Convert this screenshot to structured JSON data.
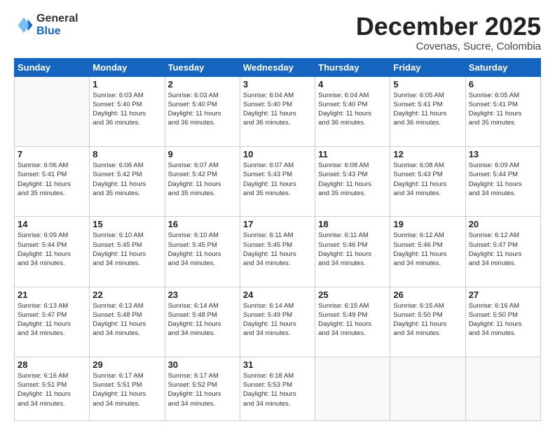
{
  "header": {
    "logo_general": "General",
    "logo_blue": "Blue",
    "month": "December 2025",
    "location": "Covenas, Sucre, Colombia"
  },
  "weekdays": [
    "Sunday",
    "Monday",
    "Tuesday",
    "Wednesday",
    "Thursday",
    "Friday",
    "Saturday"
  ],
  "weeks": [
    [
      {
        "day": "",
        "info": ""
      },
      {
        "day": "1",
        "info": "Sunrise: 6:03 AM\nSunset: 5:40 PM\nDaylight: 11 hours\nand 36 minutes."
      },
      {
        "day": "2",
        "info": "Sunrise: 6:03 AM\nSunset: 5:40 PM\nDaylight: 11 hours\nand 36 minutes."
      },
      {
        "day": "3",
        "info": "Sunrise: 6:04 AM\nSunset: 5:40 PM\nDaylight: 11 hours\nand 36 minutes."
      },
      {
        "day": "4",
        "info": "Sunrise: 6:04 AM\nSunset: 5:40 PM\nDaylight: 11 hours\nand 36 minutes."
      },
      {
        "day": "5",
        "info": "Sunrise: 6:05 AM\nSunset: 5:41 PM\nDaylight: 11 hours\nand 36 minutes."
      },
      {
        "day": "6",
        "info": "Sunrise: 6:05 AM\nSunset: 5:41 PM\nDaylight: 11 hours\nand 35 minutes."
      }
    ],
    [
      {
        "day": "7",
        "info": "Sunrise: 6:06 AM\nSunset: 5:41 PM\nDaylight: 11 hours\nand 35 minutes."
      },
      {
        "day": "8",
        "info": "Sunrise: 6:06 AM\nSunset: 5:42 PM\nDaylight: 11 hours\nand 35 minutes."
      },
      {
        "day": "9",
        "info": "Sunrise: 6:07 AM\nSunset: 5:42 PM\nDaylight: 11 hours\nand 35 minutes."
      },
      {
        "day": "10",
        "info": "Sunrise: 6:07 AM\nSunset: 5:43 PM\nDaylight: 11 hours\nand 35 minutes."
      },
      {
        "day": "11",
        "info": "Sunrise: 6:08 AM\nSunset: 5:43 PM\nDaylight: 11 hours\nand 35 minutes."
      },
      {
        "day": "12",
        "info": "Sunrise: 6:08 AM\nSunset: 5:43 PM\nDaylight: 11 hours\nand 34 minutes."
      },
      {
        "day": "13",
        "info": "Sunrise: 6:09 AM\nSunset: 5:44 PM\nDaylight: 11 hours\nand 34 minutes."
      }
    ],
    [
      {
        "day": "14",
        "info": "Sunrise: 6:09 AM\nSunset: 5:44 PM\nDaylight: 11 hours\nand 34 minutes."
      },
      {
        "day": "15",
        "info": "Sunrise: 6:10 AM\nSunset: 5:45 PM\nDaylight: 11 hours\nand 34 minutes."
      },
      {
        "day": "16",
        "info": "Sunrise: 6:10 AM\nSunset: 5:45 PM\nDaylight: 11 hours\nand 34 minutes."
      },
      {
        "day": "17",
        "info": "Sunrise: 6:11 AM\nSunset: 5:45 PM\nDaylight: 11 hours\nand 34 minutes."
      },
      {
        "day": "18",
        "info": "Sunrise: 6:11 AM\nSunset: 5:46 PM\nDaylight: 11 hours\nand 34 minutes."
      },
      {
        "day": "19",
        "info": "Sunrise: 6:12 AM\nSunset: 5:46 PM\nDaylight: 11 hours\nand 34 minutes."
      },
      {
        "day": "20",
        "info": "Sunrise: 6:12 AM\nSunset: 5:47 PM\nDaylight: 11 hours\nand 34 minutes."
      }
    ],
    [
      {
        "day": "21",
        "info": "Sunrise: 6:13 AM\nSunset: 5:47 PM\nDaylight: 11 hours\nand 34 minutes."
      },
      {
        "day": "22",
        "info": "Sunrise: 6:13 AM\nSunset: 5:48 PM\nDaylight: 11 hours\nand 34 minutes."
      },
      {
        "day": "23",
        "info": "Sunrise: 6:14 AM\nSunset: 5:48 PM\nDaylight: 11 hours\nand 34 minutes."
      },
      {
        "day": "24",
        "info": "Sunrise: 6:14 AM\nSunset: 5:49 PM\nDaylight: 11 hours\nand 34 minutes."
      },
      {
        "day": "25",
        "info": "Sunrise: 6:15 AM\nSunset: 5:49 PM\nDaylight: 11 hours\nand 34 minutes."
      },
      {
        "day": "26",
        "info": "Sunrise: 6:15 AM\nSunset: 5:50 PM\nDaylight: 11 hours\nand 34 minutes."
      },
      {
        "day": "27",
        "info": "Sunrise: 6:16 AM\nSunset: 5:50 PM\nDaylight: 11 hours\nand 34 minutes."
      }
    ],
    [
      {
        "day": "28",
        "info": "Sunrise: 6:16 AM\nSunset: 5:51 PM\nDaylight: 11 hours\nand 34 minutes."
      },
      {
        "day": "29",
        "info": "Sunrise: 6:17 AM\nSunset: 5:51 PM\nDaylight: 11 hours\nand 34 minutes."
      },
      {
        "day": "30",
        "info": "Sunrise: 6:17 AM\nSunset: 5:52 PM\nDaylight: 11 hours\nand 34 minutes."
      },
      {
        "day": "31",
        "info": "Sunrise: 6:18 AM\nSunset: 5:53 PM\nDaylight: 11 hours\nand 34 minutes."
      },
      {
        "day": "",
        "info": ""
      },
      {
        "day": "",
        "info": ""
      },
      {
        "day": "",
        "info": ""
      }
    ]
  ]
}
